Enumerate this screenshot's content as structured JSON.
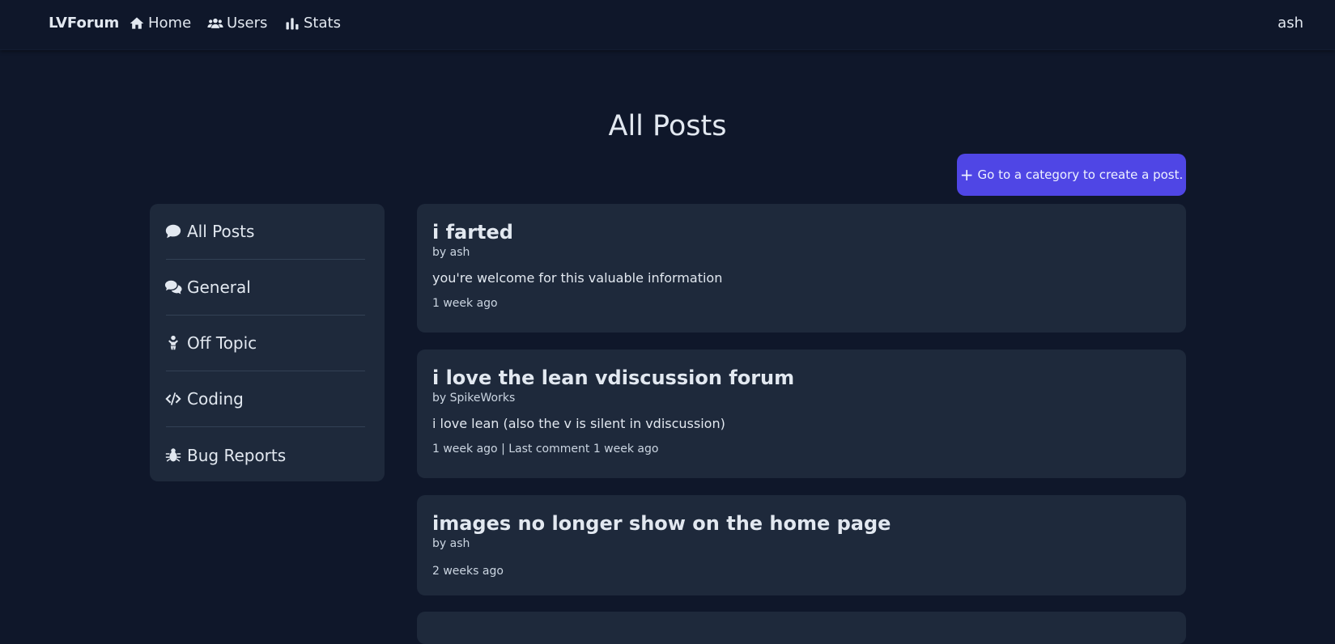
{
  "nav": {
    "brand": "LVForum",
    "links": [
      {
        "label": "Home",
        "icon": "home-icon"
      },
      {
        "label": "Users",
        "icon": "users-icon"
      },
      {
        "label": "Stats",
        "icon": "stats-icon"
      }
    ],
    "user": "ash"
  },
  "page": {
    "title": "All Posts",
    "create_button": "Go to a category to create a post."
  },
  "sidebar": {
    "items": [
      {
        "label": "All Posts",
        "icon": "comment-icon"
      },
      {
        "label": "General",
        "icon": "comments-icon"
      },
      {
        "label": "Off Topic",
        "icon": "child-icon"
      },
      {
        "label": "Coding",
        "icon": "code-icon"
      },
      {
        "label": "Bug Reports",
        "icon": "bug-icon"
      }
    ]
  },
  "posts": [
    {
      "title": "i farted",
      "author": "by ash",
      "body": "you're welcome for this valuable information",
      "meta": "1 week ago"
    },
    {
      "title": "i love the lean vdiscussion forum",
      "author": "by SpikeWorks",
      "body": "i love lean (also the v is silent in vdiscussion)",
      "meta": "1 week ago | Last comment 1 week ago"
    },
    {
      "title": "images no longer show on the home page",
      "author": "by ash",
      "body": "",
      "meta": "2 weeks ago"
    }
  ],
  "colors": {
    "background": "#0f172a",
    "card": "#1e293b",
    "accent": "#4f46e5"
  }
}
